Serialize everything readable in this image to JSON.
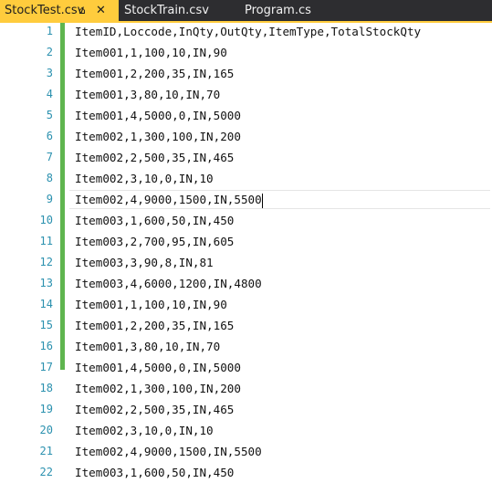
{
  "tabs": [
    {
      "label": "StockTest.csv",
      "active": true
    },
    {
      "label": "StockTrain.csv",
      "active": false
    },
    {
      "label": "Program.cs",
      "active": false
    }
  ],
  "icons": {
    "pin": "pin-icon",
    "close": "close-icon"
  },
  "colors": {
    "active_tab": "#ffcc3d",
    "tab_bar": "#2d2d30",
    "line_number": "#2b91af",
    "change_bar": "#5fb54f"
  },
  "lines": [
    {
      "n": "1",
      "text": "ItemID,Loccode,InQty,OutQty,ItemType,TotalStockQty"
    },
    {
      "n": "2",
      "text": "Item001,1,100,10,IN,90"
    },
    {
      "n": "3",
      "text": "Item001,2,200,35,IN,165"
    },
    {
      "n": "4",
      "text": "Item001,3,80,10,IN,70"
    },
    {
      "n": "5",
      "text": "Item001,4,5000,0,IN,5000"
    },
    {
      "n": "6",
      "text": "Item002,1,300,100,IN,200"
    },
    {
      "n": "7",
      "text": "Item002,2,500,35,IN,465"
    },
    {
      "n": "8",
      "text": "Item002,3,10,0,IN,10"
    },
    {
      "n": "9",
      "text": "Item002,4,9000,1500,IN,5500"
    },
    {
      "n": "10",
      "text": "Item003,1,600,50,IN,450"
    },
    {
      "n": "11",
      "text": "Item003,2,700,95,IN,605"
    },
    {
      "n": "12",
      "text": "Item003,3,90,8,IN,81"
    },
    {
      "n": "13",
      "text": "Item003,4,6000,1200,IN,4800"
    },
    {
      "n": "14",
      "text": "Item001,1,100,10,IN,90"
    },
    {
      "n": "15",
      "text": "Item001,2,200,35,IN,165"
    },
    {
      "n": "16",
      "text": "Item001,3,80,10,IN,70"
    },
    {
      "n": "17",
      "text": "Item001,4,5000,0,IN,5000"
    },
    {
      "n": "18",
      "text": "Item002,1,300,100,IN,200"
    },
    {
      "n": "19",
      "text": "Item002,2,500,35,IN,465"
    },
    {
      "n": "20",
      "text": "Item002,3,10,0,IN,10"
    },
    {
      "n": "21",
      "text": "Item002,4,9000,1500,IN,5500"
    },
    {
      "n": "22",
      "text": "Item003,1,600,50,IN,450"
    }
  ],
  "current_line": 9
}
